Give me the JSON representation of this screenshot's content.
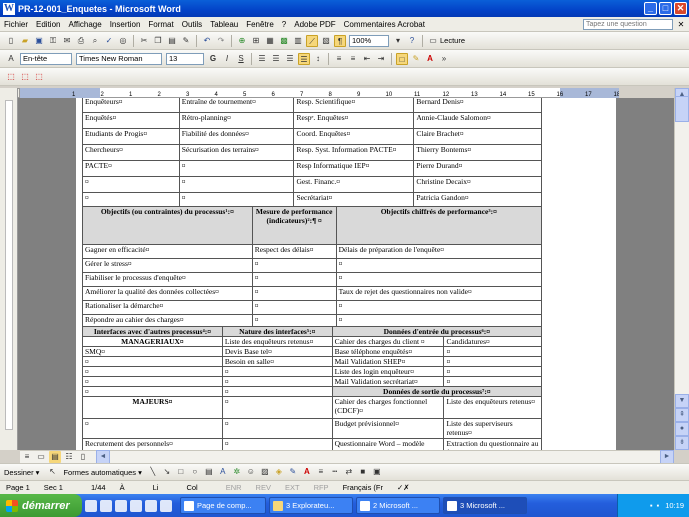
{
  "window": {
    "title": "PR-12-001_Enquetes - Microsoft Word",
    "min": "_",
    "max": "□",
    "close": "✕",
    "help_placeholder": "Tapez une question"
  },
  "menu": [
    "Fichier",
    "Edition",
    "Affichage",
    "Insertion",
    "Format",
    "Outils",
    "Tableau",
    "Fenêtre",
    "?",
    "Adobe PDF",
    "Commentaires Acrobat"
  ],
  "toolbar": {
    "zoom": "100%",
    "lecture": "Lecture",
    "style": "En-tête",
    "font": "Times New Roman",
    "size": "13",
    "bold": "G",
    "italic": "I",
    "underline": "S"
  },
  "ruler": {
    "marks": [
      "1",
      "2",
      "1",
      "2",
      "3",
      "4",
      "5",
      "6",
      "7",
      "8",
      "9",
      "10",
      "11",
      "12",
      "13",
      "14",
      "15",
      "16",
      "17",
      "18",
      "19"
    ]
  },
  "table1": {
    "rows": [
      [
        "Enquêteurs¤",
        "Entraîne de tournement¤",
        "Resp. Scientifique¤",
        "Bernard Denis¤"
      ],
      [
        "Enquêtés¤",
        "Rétro-planning¤",
        "Respᵉ. Enquêtes¤",
        "Annie-Claude Salomon¤"
      ],
      [
        "Etudiants de Progis¤",
        "Fiabilité des données¤",
        "Coord. Enquêtes¤",
        "Claire Brachet¤"
      ],
      [
        "Chercheurs¤",
        "Sécurisation des terrains¤",
        "Resp. Syst. Information PACTE¤",
        "Thierry Bontems¤"
      ],
      [
        "PACTE¤",
        "¤",
        "Resp Informatique IEP¤",
        "Pierre Durand¤"
      ],
      [
        "¤",
        "¤",
        "Gest. Financ.¤",
        "Christine Decaix¤"
      ],
      [
        "¤",
        "¤",
        "Secrétariat¤",
        "Patricia Gandon¤"
      ]
    ]
  },
  "table2": {
    "headers": [
      "Objectifs (ou contraintes) du processus¹:¤",
      "Mesure de performance (indicateurs)²:¶ ¤",
      "Objectifs chiffrés de performance³:¤"
    ],
    "rows": [
      [
        "Gagner en efficacité¤",
        "Respect des délais¤",
        "Délais de préparation de l'enquête¤"
      ],
      [
        "Gérer le stress¤",
        "¤",
        "¤"
      ],
      [
        "Fiabiliser le processus d'enquête¤",
        "¤",
        "¤"
      ],
      [
        "Améliorer la qualité des données collectées¤",
        "¤",
        "Taux de rejet des questionnaires non valide¤"
      ],
      [
        "Rationaliser la démarche¤",
        "¤",
        "¤"
      ],
      [
        "Répondre au cahier des charges¤",
        "¤",
        "¤"
      ]
    ]
  },
  "table3": {
    "headers": [
      "Interfaces avec d'autres processus⁴:¤",
      "Nature des interfaces⁵:¤",
      "Données d'entrée du processus⁶:¤"
    ],
    "managerial": "MANAGERIAUX¤",
    "rows_in": [
      [
        "SMQ¤",
        "Liste des enquêteurs retenus¤",
        "Cahier des charges du client ¤",
        "Candidatures¤"
      ],
      [
        "¤",
        "Devis Base tel¤",
        "Base téléphone enquêtés¤",
        "¤"
      ],
      [
        "¤",
        "Besoin en salle¤",
        "Mail Validation SHEP¤",
        "¤"
      ],
      [
        "¤",
        "¤",
        "Liste des login enquêteur¤",
        "¤"
      ],
      [
        "¤",
        "¤",
        "Mail Validation secrétariat¤",
        "¤"
      ]
    ],
    "out_header": "Données de sortie du processus⁷:¤",
    "majeurs": "MAJEURS¤",
    "rows_out": [
      [
        "¤",
        "¤",
        "Cahier des charges fonctionnel (CDCF)¤",
        "Liste des enquêteurs retenus¤"
      ],
      [
        "¤",
        "¤",
        "Budget prévisionnel¤",
        "Liste des superviseurs retenus¤"
      ],
      [
        "Recrutement des personnels¤",
        "¤",
        "Questionnaire Word – modèle enquête¤",
        "Extraction du questionnaire au format Word¤"
      ]
    ]
  },
  "drawbar": {
    "dessiner": "Dessiner ▾",
    "formes": "Formes automatiques ▾"
  },
  "status": {
    "page": "Page 1",
    "sec": "Sec 1",
    "pages": "1/44",
    "at": "À",
    "li": "Li",
    "col": "Col",
    "enr": "ENR",
    "rev": "REV",
    "ext": "EXT",
    "rfp": "RFP",
    "lang": "Français (Fr"
  },
  "taskbar": {
    "start": "démarrer",
    "items": [
      "Page de comp...",
      "3 Explorateu...",
      "2 Microsoft ...",
      "3 Microsoft ..."
    ],
    "clock": "10:19"
  }
}
